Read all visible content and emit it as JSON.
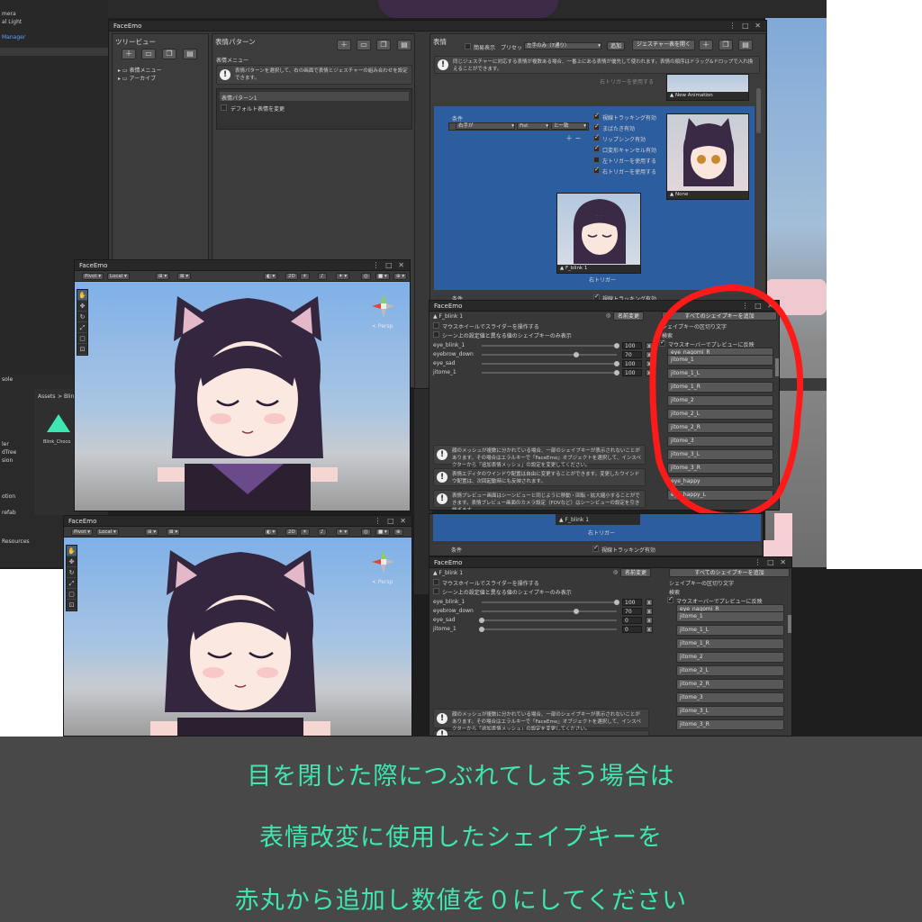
{
  "left_sidebar": {
    "items": [
      "mera",
      "al Light",
      "Manager"
    ],
    "bottom_items": [
      "sole",
      "ler",
      "dTree",
      "sion",
      "otion",
      "refab",
      "Resources"
    ]
  },
  "project_window": {
    "breadcrumb": [
      "Assets",
      "Blin"
    ],
    "asset_label": "Blink_Choco"
  },
  "faceemo_main": {
    "title": "FaceEmo",
    "tree_view": {
      "header": "ツリービュー",
      "items": [
        "表情メニュー",
        "アーカイブ"
      ]
    },
    "pattern": {
      "header": "表情パターン",
      "menu_label": "表情メニュー",
      "help": "表情パターンを選択して、右の画面で表情とジェスチャーの組み合わせを設定できます。",
      "item": "表情パターン1",
      "default_label": "デフォルト表情を変更"
    },
    "expression": {
      "header": "表情",
      "simple_label": "簡易表示",
      "preset_label": "プリセット",
      "preset_value": "左手のみ（7通り）",
      "add_label": "追加",
      "gesture_table_label": "ジェスチャー表を開く",
      "help": "同じジェスチャーに対応する表情が複数ある場合、一番上にある表情が優先して使われます。表情の順序はドラッグ&ドロップで入れ換えることができます。",
      "right_trigger_label": "右トリガーを使用する",
      "new_animation_label": "New Animation",
      "condition_label": "条件",
      "condition_hand": "右手が",
      "condition_gesture": "Fist",
      "condition_op": "と一致",
      "options": [
        "視線トラッキング有効",
        "まばたき有効",
        "リップシンク有効",
        "口変形キャンセル有効",
        "左トリガーを使用する",
        "右トリガーを使用する"
      ],
      "options_checked": [
        true,
        true,
        true,
        true,
        false,
        true
      ],
      "none_label": "None",
      "f_blink_label": "F_blink 1",
      "right_trigger_footer": "右トリガー",
      "condition_label_2": "条件",
      "eye_tracking_2": "視線トラッキング有効"
    }
  },
  "scene_view_top": {
    "title": "FaceEmo",
    "pivot_label": "Pivot",
    "local_label": "Local",
    "mode_2d": "2D",
    "persp_label": "< Persp"
  },
  "shapekey_top": {
    "title": "FaceEmo",
    "clip_name": "F_blink 1",
    "rename_label": "名前変更",
    "add_all_label": "すべてのシェイプキーを追加",
    "mouse_wheel_label": "マウスホイールでスライダーを操作する",
    "scene_diff_label": "シーン上の設定値と異なる値のシェイプキーのみ表示",
    "separator_label": "シェイプキーの区切り文字",
    "search_label": "検索",
    "mouseover_label": "マウスオーバーでプレビューに反映",
    "sliders": [
      {
        "name": "eye_blink_1",
        "value": 100
      },
      {
        "name": "eyebrow_down",
        "value": 70
      },
      {
        "name": "eye_sad",
        "value": 100
      },
      {
        "name": "jitome_1",
        "value": 100
      }
    ],
    "keys": [
      "eye_nagomi_R",
      "jitome_1",
      "jitome_1_L",
      "jitome_1_R",
      "jitome_2",
      "jitome_2_L",
      "jitome_2_R",
      "jitome_3",
      "jitome_3_L",
      "jitome_3_R",
      "eye_happy",
      "eye_happy_L"
    ],
    "help": [
      "顔のメッシュが複数に分かれている場合、一部のシェイプキーが表示されないことがあります。その場合はエラルキーで「FaceEmo」オブジェクトを選択して、インスペクターから「追加表情メッシュ」の設定を変更してください。",
      "表情エディタのウインドウ配置は自由に変更することができます。変更したウインドウ配置は、次回起動時にも反映されます。",
      "表情プレビュー画面はシーンビューと同じように移動・回転・拡大縮小することができます。表情プレビュー画面のカメラ設定（FOVなど）はシーンビューの設定を引き継ぎます。"
    ]
  },
  "scene_view_bottom": {
    "title": "FaceEmo",
    "pivot_label": "Pivot",
    "local_label": "Local",
    "mode_2d": "2D",
    "persp_label": "< Persp"
  },
  "shapekey_bottom": {
    "title": "FaceEmo",
    "clip_name": "F_blink 1",
    "rename_label": "名前変更",
    "add_all_label": "すべてのシェイプキーを追加",
    "mouse_wheel_label": "マウスホイールでスライダーを操作する",
    "scene_diff_label": "シーン上の設定値と異なる値のシェイプキーのみ表示",
    "separator_label": "シェイプキーの区切り文字",
    "search_label": "検索",
    "mouseover_label": "マウスオーバーでプレビューに反映",
    "sliders": [
      {
        "name": "eye_blink_1",
        "value": 100
      },
      {
        "name": "eyebrow_down",
        "value": 70
      },
      {
        "name": "eye_sad",
        "value": 0
      },
      {
        "name": "jitome_1",
        "value": 0
      }
    ],
    "keys": [
      "eye_nagomi_R",
      "jitome_1",
      "jitome_1_L",
      "jitome_1_R",
      "jitome_2",
      "jitome_2_L",
      "jitome_2_R",
      "jitome_3",
      "jitome_3_L",
      "jitome_3_R"
    ],
    "help": [
      "顔のメッシュが複数に分かれている場合、一部のシェイプキーが表示されないことがあります。その場合はエラルキーで「FaceEmo」オブジェクトを選択して、インスペクターから「追加表情メッシュ」の設定を変更してください。"
    ],
    "f_blink_label": "F_blink 1",
    "right_trigger_footer": "右トリガー",
    "condition_label": "条件",
    "eye_tracking": "視線トラッキング有効"
  },
  "caption": {
    "line1": "目を閉じた際につぶれてしまう場合は",
    "line2": "表情改変に使用したシェイプキーを",
    "line3": "赤丸から追加し数値を０にしてください"
  },
  "colors": {
    "caption_text": "#3ee6b2",
    "caption_bg": "#484848",
    "highlight_circle": "#ff1a1a",
    "selection_blue": "#2c5d9f"
  }
}
